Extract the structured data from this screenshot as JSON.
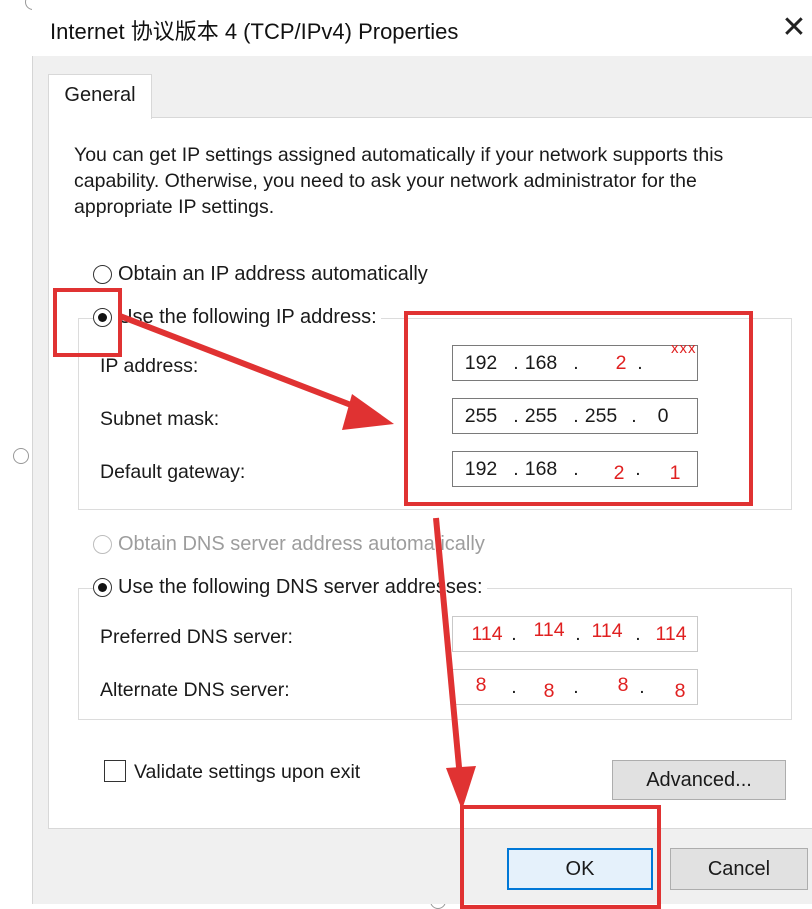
{
  "window": {
    "title": "Internet 协议版本 4 (TCP/IPv4) Properties",
    "close_glyph": "✕"
  },
  "tabs": [
    {
      "label": "General"
    }
  ],
  "description": "You can get IP settings assigned automatically if your network supports this capability. Otherwise, you need to ask your network administrator for the appropriate IP settings.",
  "ip_section": {
    "auto_label": "Obtain an IP address automatically",
    "manual_label": "Use the following IP address:",
    "selected": "manual",
    "fields": [
      {
        "label": "IP address:",
        "segments": [
          "192",
          "168",
          "2",
          ""
        ]
      },
      {
        "label": "Subnet mask:",
        "segments": [
          "255",
          "255",
          "255",
          "0"
        ]
      },
      {
        "label": "Default gateway:",
        "segments": [
          "192",
          "168",
          "2",
          "1"
        ]
      }
    ]
  },
  "dns_section": {
    "auto_label": "Obtain DNS server address automatically",
    "manual_label": "Use the following DNS server addresses:",
    "selected": "manual",
    "fields": [
      {
        "label": "Preferred DNS server:",
        "segments": [
          "114",
          "114",
          "114",
          "114"
        ]
      },
      {
        "label": "Alternate DNS server:",
        "segments": [
          "8",
          "8",
          "8",
          "8"
        ]
      }
    ]
  },
  "validate_label": "Validate settings upon exit",
  "buttons": {
    "advanced": "Advanced...",
    "ok": "OK",
    "cancel": "Cancel"
  },
  "annotations": {
    "placeholder_text": "xxx",
    "highlight_color": "#e03232"
  }
}
